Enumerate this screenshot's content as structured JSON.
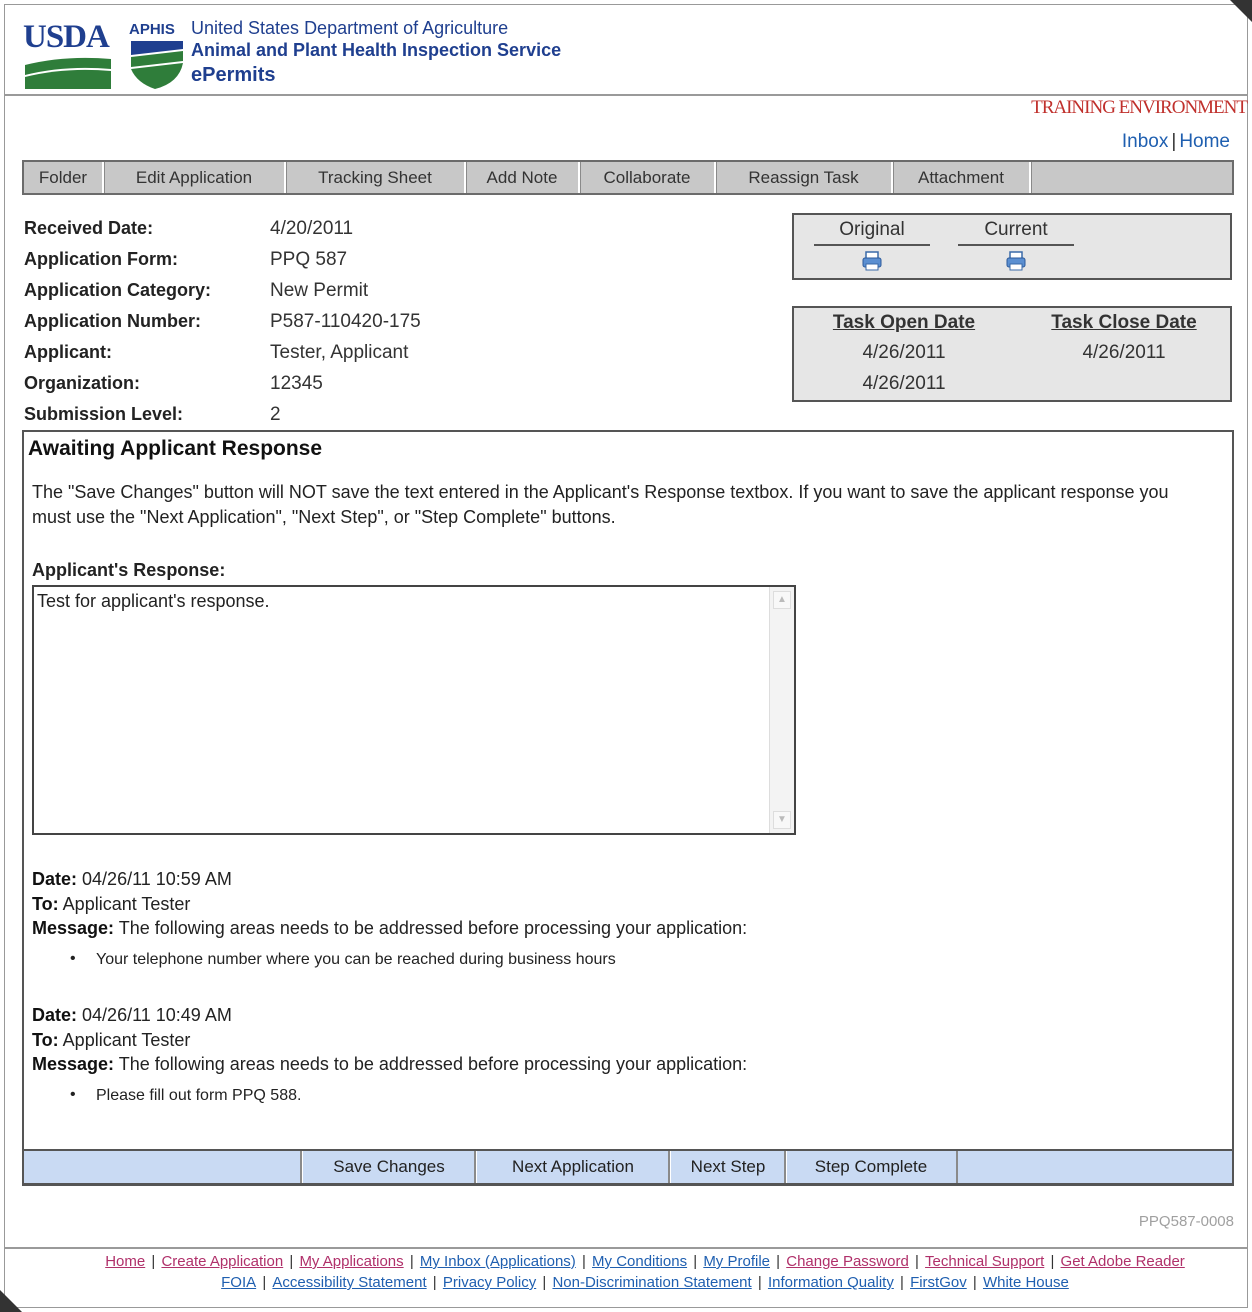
{
  "header": {
    "logo_usda": "USDA",
    "logo_aphis": "APHIS",
    "dept": "United States Department of Agriculture",
    "agency": "Animal and Plant Health Inspection Service",
    "app": "ePermits"
  },
  "environment_label": "TRAINING ENVIRONMENT",
  "top_links": {
    "inbox": "Inbox",
    "home": "Home"
  },
  "tabs": [
    "Folder",
    "Edit Application",
    "Tracking Sheet",
    "Add Note",
    "Collaborate",
    "Reassign Task",
    "Attachment"
  ],
  "details": [
    {
      "label": "Received Date:",
      "value": "4/20/2011"
    },
    {
      "label": "Application Form:",
      "value": "PPQ 587"
    },
    {
      "label": "Application Category:",
      "value": "New Permit"
    },
    {
      "label": "Application Number:",
      "value": "P587-110420-175"
    },
    {
      "label": "Applicant:",
      "value": "Tester, Applicant"
    },
    {
      "label": "Organization:",
      "value": "12345"
    },
    {
      "label": "Submission Level:",
      "value": "2"
    }
  ],
  "versions": {
    "original": "Original",
    "current": "Current",
    "print_icon": "printer-icon"
  },
  "tasks": {
    "open_header": "Task Open Date",
    "close_header": "Task Close Date",
    "open_dates": [
      "4/26/2011",
      "4/26/2011"
    ],
    "close_dates": [
      "4/26/2011"
    ]
  },
  "panel": {
    "title": "Awaiting Applicant Response",
    "note": "The \"Save Changes\" button will NOT save the text entered in the Applicant's Response textbox. If you want to save the applicant response you must use the \"Next Application\", \"Next Step\", or \"Step Complete\" buttons.",
    "response_label": "Applicant's Response:",
    "response_value": "Test for applicant's response."
  },
  "messages": [
    {
      "date_label": "Date:",
      "date": "04/26/11 10:59 AM",
      "to_label": "To:",
      "to": "Applicant Tester",
      "msg_label": "Message:",
      "msg": "The following areas needs to be addressed before processing your application:",
      "item": "Your telephone number where you can be reached during business hours"
    },
    {
      "date_label": "Date:",
      "date": "04/26/11 10:49 AM",
      "to_label": "To:",
      "to": "Applicant Tester",
      "msg_label": "Message:",
      "msg": "The following areas needs to be addressed before processing your application:",
      "item": "Please fill out form PPQ 588."
    }
  ],
  "buttons": {
    "save": "Save Changes",
    "next_app": "Next Application",
    "next_step": "Next Step",
    "step_complete": "Step Complete"
  },
  "doc_id": "PPQ587-0008",
  "footer": {
    "home": "Home",
    "create": "Create Application",
    "my_apps": "My Applications",
    "inbox": "My Inbox (Applications)",
    "conditions": "My Conditions",
    "profile": "My Profile",
    "password": "Change Password",
    "support": "Technical Support",
    "adobe": "Get Adobe Reader",
    "foia": "FOIA",
    "access": "Accessibility Statement",
    "privacy": "Privacy Policy",
    "nondisc": "Non-Discrimination Statement",
    "quality": "Information Quality",
    "firstgov": "FirstGov",
    "whitehouse": "White House"
  },
  "colors": {
    "brand_blue": "#1f3f8f",
    "training_red": "#c0302c",
    "button_bar": "#c9daf3",
    "tab_bar": "#c8c8c8"
  }
}
